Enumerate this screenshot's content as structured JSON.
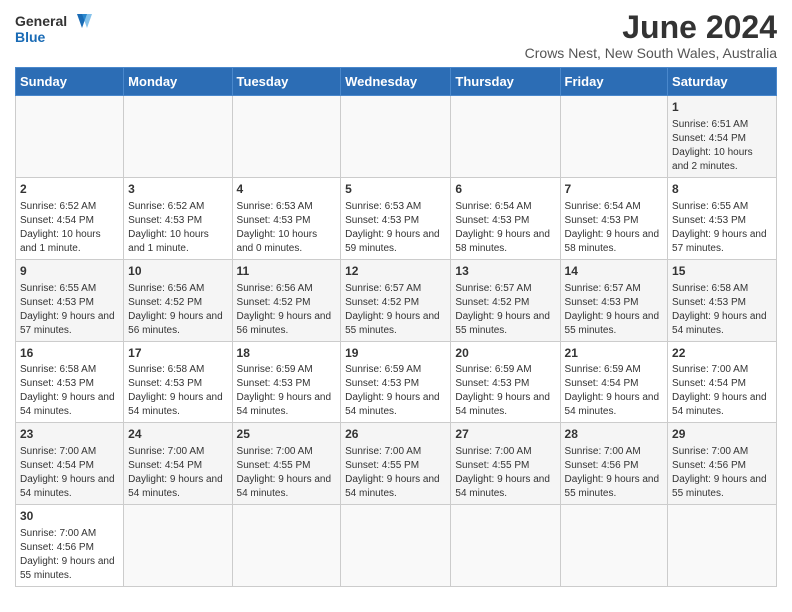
{
  "logo": {
    "text_general": "General",
    "text_blue": "Blue"
  },
  "header": {
    "month_year": "June 2024",
    "location": "Crows Nest, New South Wales, Australia"
  },
  "weekdays": [
    "Sunday",
    "Monday",
    "Tuesday",
    "Wednesday",
    "Thursday",
    "Friday",
    "Saturday"
  ],
  "weeks": [
    [
      {
        "day": "",
        "info": ""
      },
      {
        "day": "",
        "info": ""
      },
      {
        "day": "",
        "info": ""
      },
      {
        "day": "",
        "info": ""
      },
      {
        "day": "",
        "info": ""
      },
      {
        "day": "",
        "info": ""
      },
      {
        "day": "1",
        "info": "Sunrise: 6:51 AM\nSunset: 4:54 PM\nDaylight: 10 hours\nand 2 minutes."
      }
    ],
    [
      {
        "day": "2",
        "info": "Sunrise: 6:52 AM\nSunset: 4:54 PM\nDaylight: 10 hours\nand 1 minute."
      },
      {
        "day": "3",
        "info": "Sunrise: 6:52 AM\nSunset: 4:53 PM\nDaylight: 10 hours\nand 1 minute."
      },
      {
        "day": "4",
        "info": "Sunrise: 6:53 AM\nSunset: 4:53 PM\nDaylight: 10 hours\nand 0 minutes."
      },
      {
        "day": "5",
        "info": "Sunrise: 6:53 AM\nSunset: 4:53 PM\nDaylight: 9 hours\nand 59 minutes."
      },
      {
        "day": "6",
        "info": "Sunrise: 6:54 AM\nSunset: 4:53 PM\nDaylight: 9 hours\nand 58 minutes."
      },
      {
        "day": "7",
        "info": "Sunrise: 6:54 AM\nSunset: 4:53 PM\nDaylight: 9 hours\nand 58 minutes."
      },
      {
        "day": "8",
        "info": "Sunrise: 6:55 AM\nSunset: 4:53 PM\nDaylight: 9 hours\nand 57 minutes."
      }
    ],
    [
      {
        "day": "9",
        "info": "Sunrise: 6:55 AM\nSunset: 4:53 PM\nDaylight: 9 hours\nand 57 minutes."
      },
      {
        "day": "10",
        "info": "Sunrise: 6:56 AM\nSunset: 4:52 PM\nDaylight: 9 hours\nand 56 minutes."
      },
      {
        "day": "11",
        "info": "Sunrise: 6:56 AM\nSunset: 4:52 PM\nDaylight: 9 hours\nand 56 minutes."
      },
      {
        "day": "12",
        "info": "Sunrise: 6:57 AM\nSunset: 4:52 PM\nDaylight: 9 hours\nand 55 minutes."
      },
      {
        "day": "13",
        "info": "Sunrise: 6:57 AM\nSunset: 4:52 PM\nDaylight: 9 hours\nand 55 minutes."
      },
      {
        "day": "14",
        "info": "Sunrise: 6:57 AM\nSunset: 4:53 PM\nDaylight: 9 hours\nand 55 minutes."
      },
      {
        "day": "15",
        "info": "Sunrise: 6:58 AM\nSunset: 4:53 PM\nDaylight: 9 hours\nand 54 minutes."
      }
    ],
    [
      {
        "day": "16",
        "info": "Sunrise: 6:58 AM\nSunset: 4:53 PM\nDaylight: 9 hours\nand 54 minutes."
      },
      {
        "day": "17",
        "info": "Sunrise: 6:58 AM\nSunset: 4:53 PM\nDaylight: 9 hours\nand 54 minutes."
      },
      {
        "day": "18",
        "info": "Sunrise: 6:59 AM\nSunset: 4:53 PM\nDaylight: 9 hours\nand 54 minutes."
      },
      {
        "day": "19",
        "info": "Sunrise: 6:59 AM\nSunset: 4:53 PM\nDaylight: 9 hours\nand 54 minutes."
      },
      {
        "day": "20",
        "info": "Sunrise: 6:59 AM\nSunset: 4:53 PM\nDaylight: 9 hours\nand 54 minutes."
      },
      {
        "day": "21",
        "info": "Sunrise: 6:59 AM\nSunset: 4:54 PM\nDaylight: 9 hours\nand 54 minutes."
      },
      {
        "day": "22",
        "info": "Sunrise: 7:00 AM\nSunset: 4:54 PM\nDaylight: 9 hours\nand 54 minutes."
      }
    ],
    [
      {
        "day": "23",
        "info": "Sunrise: 7:00 AM\nSunset: 4:54 PM\nDaylight: 9 hours\nand 54 minutes."
      },
      {
        "day": "24",
        "info": "Sunrise: 7:00 AM\nSunset: 4:54 PM\nDaylight: 9 hours\nand 54 minutes."
      },
      {
        "day": "25",
        "info": "Sunrise: 7:00 AM\nSunset: 4:55 PM\nDaylight: 9 hours\nand 54 minutes."
      },
      {
        "day": "26",
        "info": "Sunrise: 7:00 AM\nSunset: 4:55 PM\nDaylight: 9 hours\nand 54 minutes."
      },
      {
        "day": "27",
        "info": "Sunrise: 7:00 AM\nSunset: 4:55 PM\nDaylight: 9 hours\nand 54 minutes."
      },
      {
        "day": "28",
        "info": "Sunrise: 7:00 AM\nSunset: 4:56 PM\nDaylight: 9 hours\nand 55 minutes."
      },
      {
        "day": "29",
        "info": "Sunrise: 7:00 AM\nSunset: 4:56 PM\nDaylight: 9 hours\nand 55 minutes."
      }
    ],
    [
      {
        "day": "30",
        "info": "Sunrise: 7:00 AM\nSunset: 4:56 PM\nDaylight: 9 hours\nand 55 minutes."
      },
      {
        "day": "",
        "info": ""
      },
      {
        "day": "",
        "info": ""
      },
      {
        "day": "",
        "info": ""
      },
      {
        "day": "",
        "info": ""
      },
      {
        "day": "",
        "info": ""
      },
      {
        "day": "",
        "info": ""
      }
    ]
  ]
}
